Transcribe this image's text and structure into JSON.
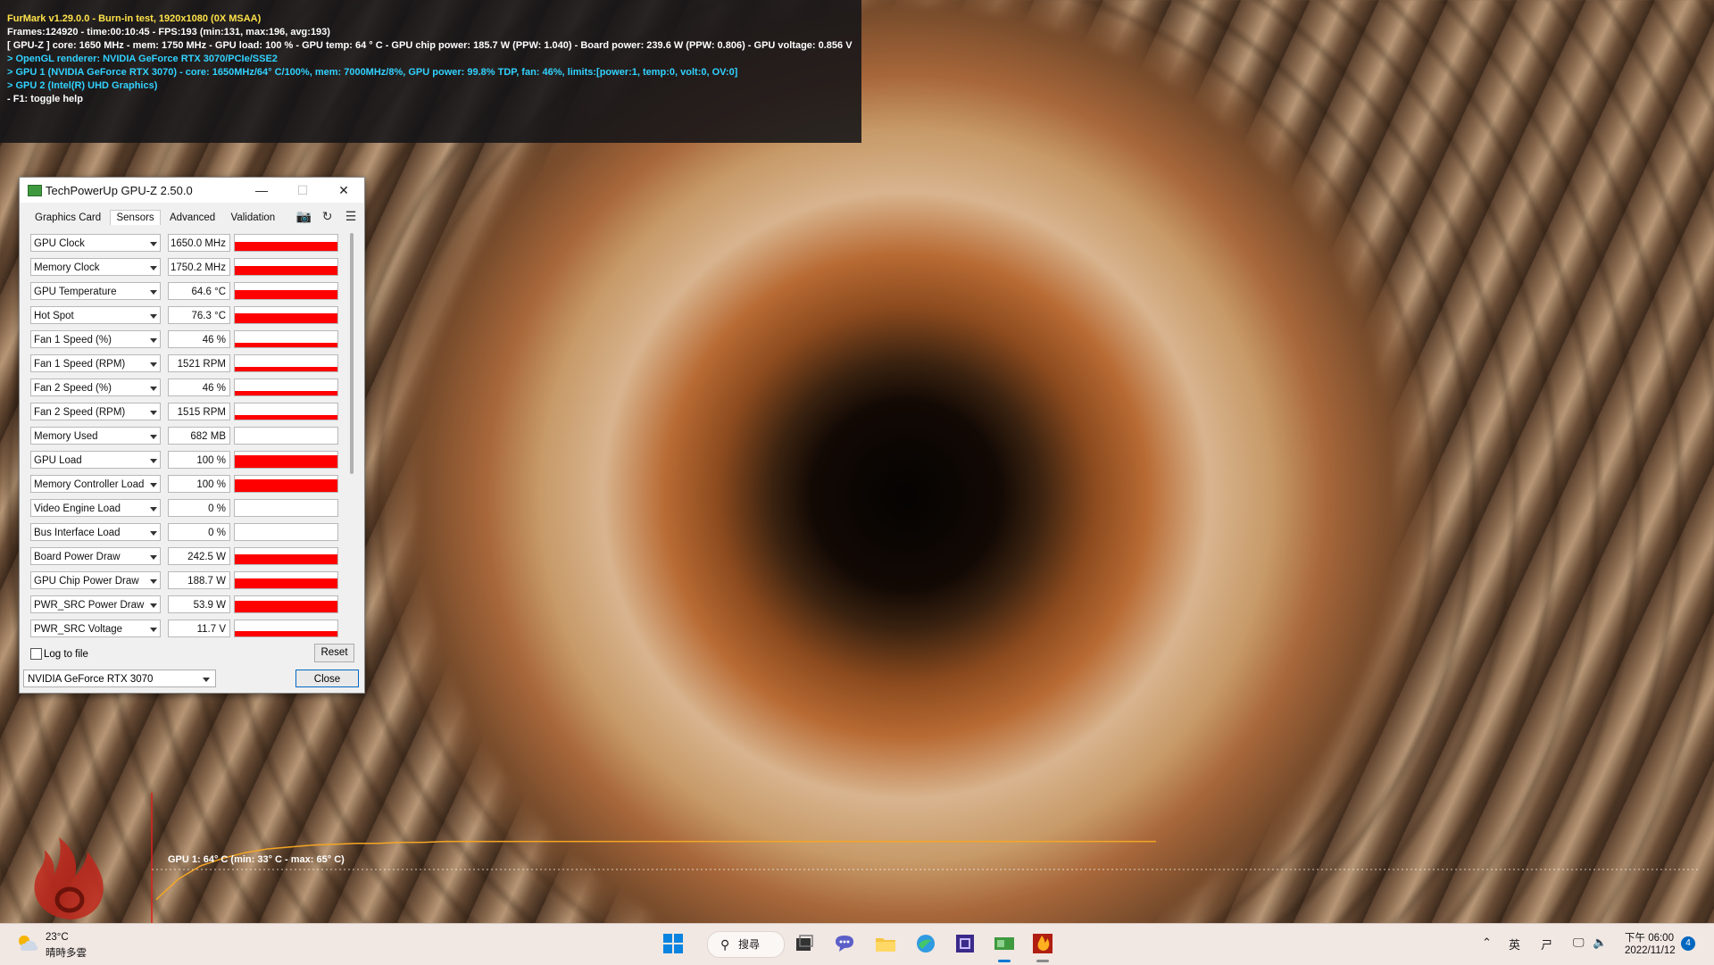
{
  "furmark": {
    "line1": "FurMark v1.29.0.0 - Burn-in test, 1920x1080 (0X MSAA)",
    "line2": "Frames:124920 - time:00:10:45 - FPS:193 (min:131, max:196, avg:193)",
    "line3": "[ GPU-Z ] core: 1650 MHz - mem: 1750 MHz - GPU load: 100 % - GPU temp: 64 ° C - GPU chip power: 185.7 W (PPW: 1.040) - Board power: 239.6 W (PPW: 0.806) - GPU voltage: 0.856 V",
    "line4": "> OpenGL renderer: NVIDIA GeForce RTX 3070/PCIe/SSE2",
    "line5": "> GPU 1 (NVIDIA GeForce RTX 3070) - core: 1650MHz/64° C/100%, mem: 7000MHz/8%, GPU power: 99.8% TDP, fan: 46%, limits:[power:1, temp:0, volt:0, OV:0]",
    "line6": "> GPU 2 (Intel(R) UHD Graphics)",
    "line7": "- F1: toggle help",
    "temp_label": "GPU 1: 64° C (min: 33° C - max: 65° C)",
    "temp_curve": [
      33,
      44,
      51,
      55,
      58,
      60,
      61,
      62,
      62.5,
      63,
      63,
      63.5,
      63.5,
      64,
      64,
      64,
      64,
      64,
      64,
      64,
      64,
      64,
      64,
      64,
      64,
      64,
      64,
      64,
      64,
      64,
      64,
      64,
      64,
      64,
      64,
      64,
      64,
      64,
      64,
      64,
      64,
      64,
      64,
      64,
      64,
      64
    ],
    "colors": {
      "yellow": "#ffe34a",
      "cyan": "#31d2ff",
      "curve": "#f5a623"
    }
  },
  "gpuz": {
    "title": "TechPowerUp GPU-Z 2.50.0",
    "tabs": [
      "Graphics Card",
      "Sensors",
      "Advanced",
      "Validation"
    ],
    "active_tab": "Sensors",
    "sensors": [
      {
        "name": "GPU Clock",
        "value": "1650.0 MHz",
        "level": 0.55
      },
      {
        "name": "Memory Clock",
        "value": "1750.2 MHz",
        "level": 0.55
      },
      {
        "name": "GPU Temperature",
        "value": "64.6 °C",
        "level": 0.55
      },
      {
        "name": "Hot Spot",
        "value": "76.3 °C",
        "level": 0.62
      },
      {
        "name": "Fan 1 Speed (%)",
        "value": "46 %",
        "level": 0.3
      },
      {
        "name": "Fan 1 Speed (RPM)",
        "value": "1521 RPM",
        "level": 0.3
      },
      {
        "name": "Fan 2 Speed (%)",
        "value": "46 %",
        "level": 0.3
      },
      {
        "name": "Fan 2 Speed (RPM)",
        "value": "1515 RPM",
        "level": 0.3
      },
      {
        "name": "Memory Used",
        "value": "682 MB",
        "level": 0.0
      },
      {
        "name": "GPU Load",
        "value": "100 %",
        "level": 0.78
      },
      {
        "name": "Memory Controller Load",
        "value": "100 %",
        "level": 0.78
      },
      {
        "name": "Video Engine Load",
        "value": "0 %",
        "level": 0.0
      },
      {
        "name": "Bus Interface Load",
        "value": "0 %",
        "level": 0.0
      },
      {
        "name": "Board Power Draw",
        "value": "242.5 W",
        "level": 0.62
      },
      {
        "name": "GPU Chip Power Draw",
        "value": "188.7 W",
        "level": 0.62
      },
      {
        "name": "PWR_SRC Power Draw",
        "value": "53.9 W",
        "level": 0.7
      },
      {
        "name": "PWR_SRC Voltage",
        "value": "11.7 V",
        "level": 0.35
      }
    ],
    "log_label": "Log to file",
    "reset_label": "Reset",
    "device": "NVIDIA GeForce RTX 3070",
    "close_label": "Close",
    "bar_color": "#ff0000"
  },
  "taskbar": {
    "temperature": "23°C",
    "condition": "晴時多雲",
    "search_label": "搜尋",
    "ime": "英",
    "time": "下午 06:00",
    "date": "2022/11/12",
    "notifications": "4",
    "accent": "#0078d4"
  }
}
